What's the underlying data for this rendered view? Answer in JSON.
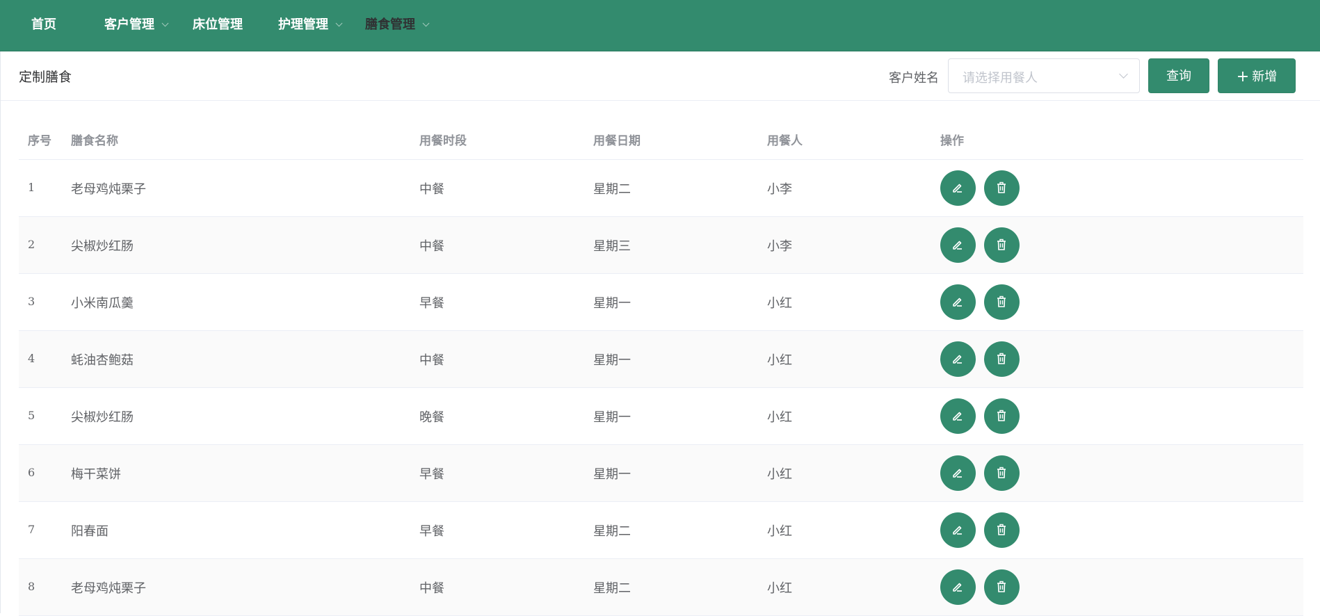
{
  "nav": {
    "items": [
      {
        "label": "首页"
      },
      {
        "label": "客户管理"
      },
      {
        "label": "床位管理"
      },
      {
        "label": "护理管理"
      },
      {
        "label": "膳食管理"
      }
    ]
  },
  "toolbar": {
    "title": "定制膳食",
    "filter_label": "客户姓名",
    "select_placeholder": "请选择用餐人",
    "query_label": "查询",
    "add_label": "新增"
  },
  "table": {
    "headers": [
      "序号",
      "膳食名称",
      "用餐时段",
      "用餐日期",
      "用餐人",
      "操作"
    ],
    "rows": [
      {
        "no": "1",
        "name": "老母鸡炖栗子",
        "period": "中餐",
        "date": "星期二",
        "person": "小李"
      },
      {
        "no": "2",
        "name": "尖椒炒红肠",
        "period": "中餐",
        "date": "星期三",
        "person": "小李"
      },
      {
        "no": "3",
        "name": "小米南瓜羹",
        "period": "早餐",
        "date": "星期一",
        "person": "小红"
      },
      {
        "no": "4",
        "name": "蚝油杏鲍菇",
        "period": "中餐",
        "date": "星期一",
        "person": "小红"
      },
      {
        "no": "5",
        "name": "尖椒炒红肠",
        "period": "晚餐",
        "date": "星期一",
        "person": "小红"
      },
      {
        "no": "6",
        "name": "梅干菜饼",
        "period": "早餐",
        "date": "星期一",
        "person": "小红"
      },
      {
        "no": "7",
        "name": "阳春面",
        "period": "早餐",
        "date": "星期二",
        "person": "小红"
      },
      {
        "no": "8",
        "name": "老母鸡炖栗子",
        "period": "中餐",
        "date": "星期二",
        "person": "小红"
      }
    ]
  },
  "icons": {
    "edit": "pencil-icon",
    "delete": "trash-icon"
  },
  "colors": {
    "brand": "#338b6e",
    "header_text": "#909399",
    "cell_text": "#606266"
  }
}
